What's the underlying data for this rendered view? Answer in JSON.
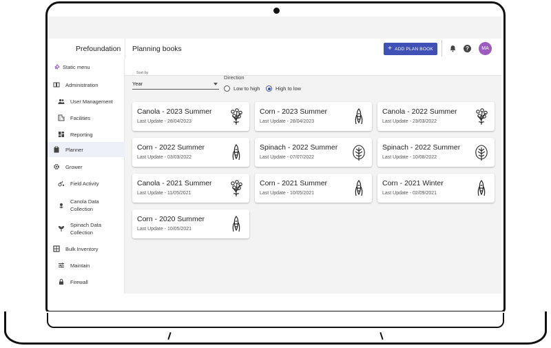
{
  "app": {
    "brand": "Prefoundation",
    "page_title": "Planning books"
  },
  "header": {
    "add_button_label": "ADD PLAN BOOK",
    "avatar_initials": "MA",
    "accent_color": "#3f51b5",
    "avatar_color": "#9c5bbf"
  },
  "sidebar": {
    "items": [
      {
        "label": "Static menu",
        "icon": "pin-icon"
      },
      {
        "label": "Administration",
        "icon": "book-icon"
      },
      {
        "label": "User Management",
        "icon": "people-icon"
      },
      {
        "label": "Facilities",
        "icon": "building-icon"
      },
      {
        "label": "Reporting",
        "icon": "dashboard-icon"
      },
      {
        "label": "Planner",
        "icon": "clipboard-icon",
        "active": true
      },
      {
        "label": "Grower",
        "icon": "gear-icon"
      },
      {
        "label": "Field Activity",
        "icon": "tractor-icon"
      },
      {
        "label": "Canola Data Collection",
        "icon": "flower-icon"
      },
      {
        "label": "Spinach Data Collection",
        "icon": "sprout-icon"
      },
      {
        "label": "Bulk Inventory",
        "icon": "grid-icon"
      },
      {
        "label": "Maintain",
        "icon": "sliders-icon"
      },
      {
        "label": "Firewall",
        "icon": "lock-icon"
      }
    ]
  },
  "controls": {
    "sort_by_label": "Sort by",
    "sort_value": "Year",
    "direction_label": "Direction",
    "low_to_high": "Low to high",
    "high_to_low": "High to low",
    "selected_direction": "High to low"
  },
  "cards": [
    {
      "title": "Canola - 2023 Summer",
      "updated": "Last Update - 28/04/2023",
      "icon": "canola-icon"
    },
    {
      "title": "Corn - 2023 Summer",
      "updated": "Last Update - 28/04/2023",
      "icon": "corn-icon"
    },
    {
      "title": "Canola - 2022 Summer",
      "updated": "Last Update - 23/03/2022",
      "icon": "canola-icon"
    },
    {
      "title": "Corn - 2022 Summer",
      "updated": "Last Update - 03/03/2022",
      "icon": "corn-icon"
    },
    {
      "title": "Spinach - 2022 Summer",
      "updated": "Last Update - 07/07/2022",
      "icon": "spinach-icon"
    },
    {
      "title": "Spinach - 2022 Summer",
      "updated": "Last Update - 10/08/2022",
      "icon": "spinach-icon"
    },
    {
      "title": "Canola - 2021 Summer",
      "updated": "Last Update - 11/05/2021",
      "icon": "canola-icon"
    },
    {
      "title": "Corn - 2021 Summer",
      "updated": "Last Update - 10/05/2021",
      "icon": "corn-icon"
    },
    {
      "title": "Corn - 2021 Winter",
      "updated": "Last Update - 02/09/2021",
      "icon": "corn-icon"
    },
    {
      "title": "Corn - 2020 Summer",
      "updated": "Last Update - 10/05/2021",
      "icon": "corn-icon"
    }
  ]
}
